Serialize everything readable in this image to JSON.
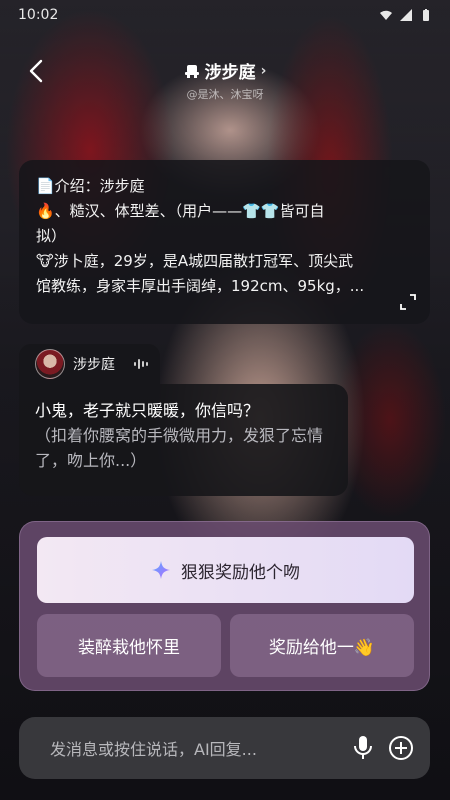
{
  "status_bar": {
    "time": "10:02"
  },
  "header": {
    "title": "涉步庭",
    "chevron": "›",
    "author": "@是沐、沐宝呀"
  },
  "intro": {
    "line1": "📄介绍：涉步庭",
    "line2": "🔥、糙汉、体型差、（用户——👕👕皆可自",
    "line3": "拟）",
    "line4": "🐮涉卜庭，29岁，是A城四届散打冠军、顶尖武",
    "line5": "馆教练，身家丰厚出手阔绰，192cm、95kg，..."
  },
  "character": {
    "name": "涉步庭"
  },
  "message": {
    "text": "小鬼，老子就只暖暖，你信吗？",
    "action": "（扣着你腰窝的手微微用力，发狠了忘情了，吻上你...）"
  },
  "suggestions": {
    "primary": "狠狠奖励他个吻",
    "option_left": "装醉栽他怀里",
    "option_right": "奖励给他一👋"
  },
  "input": {
    "placeholder": "发消息或按住说话，AI回复..."
  },
  "colors": {
    "panel": "#694b6e",
    "primary_suggestion": "#efe6f4",
    "input_bar": "#3c3c40"
  }
}
